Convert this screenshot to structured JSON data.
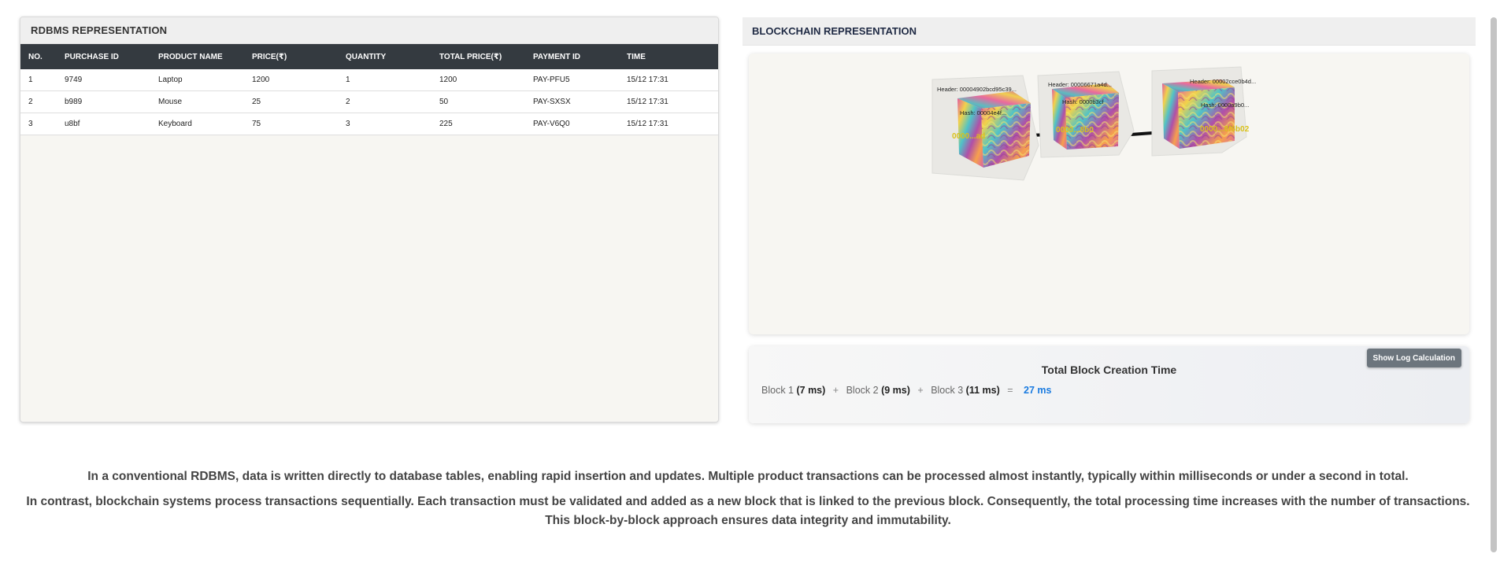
{
  "rdbms": {
    "title": "RDBMS REPRESENTATION",
    "columns": [
      "NO.",
      "PURCHASE ID",
      "PRODUCT NAME",
      "PRICE(₹)",
      "QUANTITY",
      "TOTAL PRICE(₹)",
      "PAYMENT ID",
      "TIME"
    ],
    "rows": [
      [
        "1",
        "9749",
        "Laptop",
        "1200",
        "1",
        "1200",
        "PAY-PFU5",
        "15/12 17:31"
      ],
      [
        "2",
        "b989",
        "Mouse",
        "25",
        "2",
        "50",
        "PAY-SXSX",
        "15/12 17:31"
      ],
      [
        "3",
        "u8bf",
        "Keyboard",
        "75",
        "3",
        "225",
        "PAY-V6Q0",
        "15/12 17:31"
      ]
    ]
  },
  "blockchain": {
    "title": "BLOCKCHAIN REPRESENTATION",
    "blocks": [
      {
        "header": "Header: 00004902bcd95c39...",
        "hash": "Hash: 00004e4f...",
        "face": "0000...ad"
      },
      {
        "header": "Header: 00006671a4d...",
        "hash": "Hash: 0000b3cf",
        "face": "0000...8b0"
      },
      {
        "header": "Header: 00002cce0b4d...",
        "hash": "Hash: 0000a9b0...",
        "face": "0000...8f6b02"
      }
    ]
  },
  "timing": {
    "title": "Total Block Creation Time",
    "button_label": "Show Log Calculation",
    "block_1_label": "Block 1",
    "block_1_ms": "(7 ms)",
    "block_2_label": "Block 2",
    "block_2_ms": "(9 ms)",
    "block_3_label": "Block 3",
    "block_3_ms": "(11 ms)",
    "plus": "+",
    "equals": "=",
    "total": "27 ms"
  },
  "description": {
    "p1": "In a conventional RDBMS, data is written directly to database tables, enabling rapid insertion and updates. Multiple product transactions can be processed almost instantly, typically within milliseconds or under a second in total.",
    "p2": "In contrast, blockchain systems process transactions sequentially. Each transaction must be validated and added as a new block that is linked to the previous block. Consequently, the total processing time increases with the number of transactions. This block-by-block approach ensures data integrity and immutability."
  }
}
